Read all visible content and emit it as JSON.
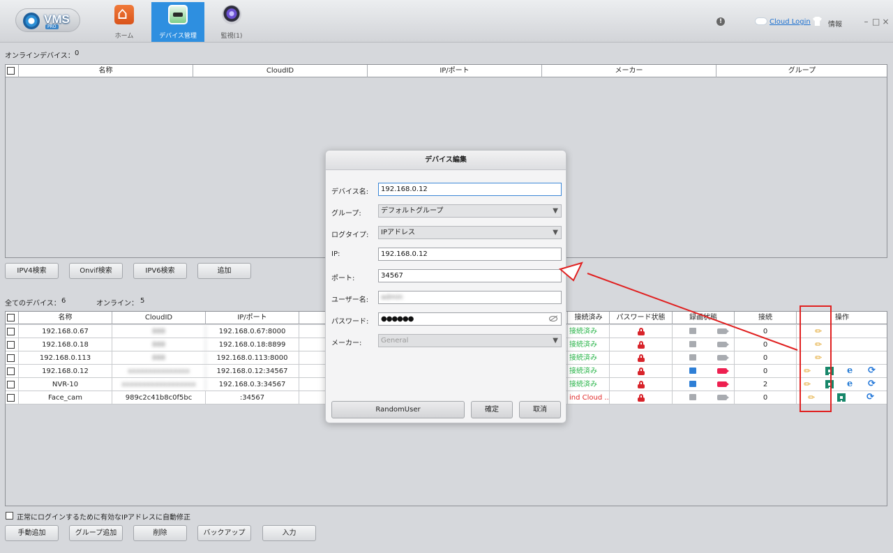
{
  "app": {
    "logo_text": "VMS",
    "logo_sub": "PRO",
    "nav": [
      {
        "label": "ホーム",
        "icon": "home-icon"
      },
      {
        "label": "デバイス管理",
        "icon": "device-manager-icon"
      },
      {
        "label": "監視(1)",
        "icon": "monitor-camera-icon"
      }
    ],
    "cloud_login": "Cloud Login",
    "info_label": "情報",
    "window_buttons": [
      "–",
      "□",
      "×"
    ]
  },
  "online_section": {
    "label": "オンラインデバイス：",
    "count": "0",
    "columns": [
      "名称",
      "CloudID",
      "IP/ポート",
      "メーカー",
      "グループ"
    ]
  },
  "search_buttons": [
    "IPV4検索",
    "Onvif検索",
    "IPV6検索",
    "追加"
  ],
  "all_devices": {
    "total_label": "全てのデバイス：",
    "total": "6",
    "online_label": "オンライン：",
    "online": "5",
    "columns": [
      "名称",
      "CloudID",
      "IP/ポート",
      "",
      "接続済み",
      "パスワード状態",
      "録画状態",
      "接続",
      "操作"
    ],
    "rows": [
      {
        "name": "192.168.0.67",
        "cloud_id": "888",
        "ip": "192.168.0.67:8000",
        "status": "接続済み",
        "conn": "0",
        "rec_active": false,
        "full_ops": false
      },
      {
        "name": "192.168.0.18",
        "cloud_id": "888",
        "ip": "192.168.0.18:8899",
        "status": "接続済み",
        "conn": "0",
        "rec_active": false,
        "full_ops": false
      },
      {
        "name": "192.168.0.113",
        "cloud_id": "888",
        "ip": "192.168.0.113:8000",
        "status": "接続済み",
        "conn": "0",
        "rec_active": false,
        "full_ops": false
      },
      {
        "name": "192.168.0.12",
        "cloud_id": "xxxxxxxxxxxxxxx",
        "ip": "192.168.0.12:34567",
        "status": "接続済み",
        "conn": "0",
        "rec_active": true,
        "full_ops": true
      },
      {
        "name": "NVR-10",
        "cloud_id": "xxxxxxxxxxxxxxxxxx",
        "ip": "192.168.0.3:34567",
        "status": "接続済み",
        "conn": "2",
        "rec_active": true,
        "full_ops": true
      },
      {
        "name": "Face_cam",
        "cloud_id": "989c2c41b8c0f5bc",
        "ip": ":34567",
        "status": "ind Cloud ...",
        "conn": "0",
        "rec_active": false,
        "full_ops": true
      }
    ]
  },
  "auto_fix_label": "正常にログインするために有効なIPアドレスに自動修正",
  "bottom_buttons": [
    "手動追加",
    "グループ追加",
    "削除",
    "バックアップ",
    "入力"
  ],
  "dialog": {
    "title": "デバイス編集",
    "fields": {
      "device_name": {
        "label": "デバイス名:",
        "value": "192.168.0.12"
      },
      "group": {
        "label": "グループ:",
        "value": "デフォルトグループ"
      },
      "login_type": {
        "label": "ログタイプ:",
        "value": "IPアドレス"
      },
      "ip": {
        "label": "IP:",
        "value": "192.168.0.12"
      },
      "port": {
        "label": "ポート:",
        "value": "34567"
      },
      "username": {
        "label": "ユーザー名:",
        "value": "admin"
      },
      "password": {
        "label": "パスワード:",
        "value": "●●●●●●"
      },
      "vendor": {
        "label": "メーカー:",
        "value": "General"
      }
    },
    "buttons": {
      "random_user": "RandomUser",
      "ok": "確定",
      "cancel": "取消"
    }
  },
  "colors": {
    "accent": "#2e8fe0",
    "annotation": "#e02020",
    "connected": "#2ab54a",
    "lock": "#d8232a"
  }
}
